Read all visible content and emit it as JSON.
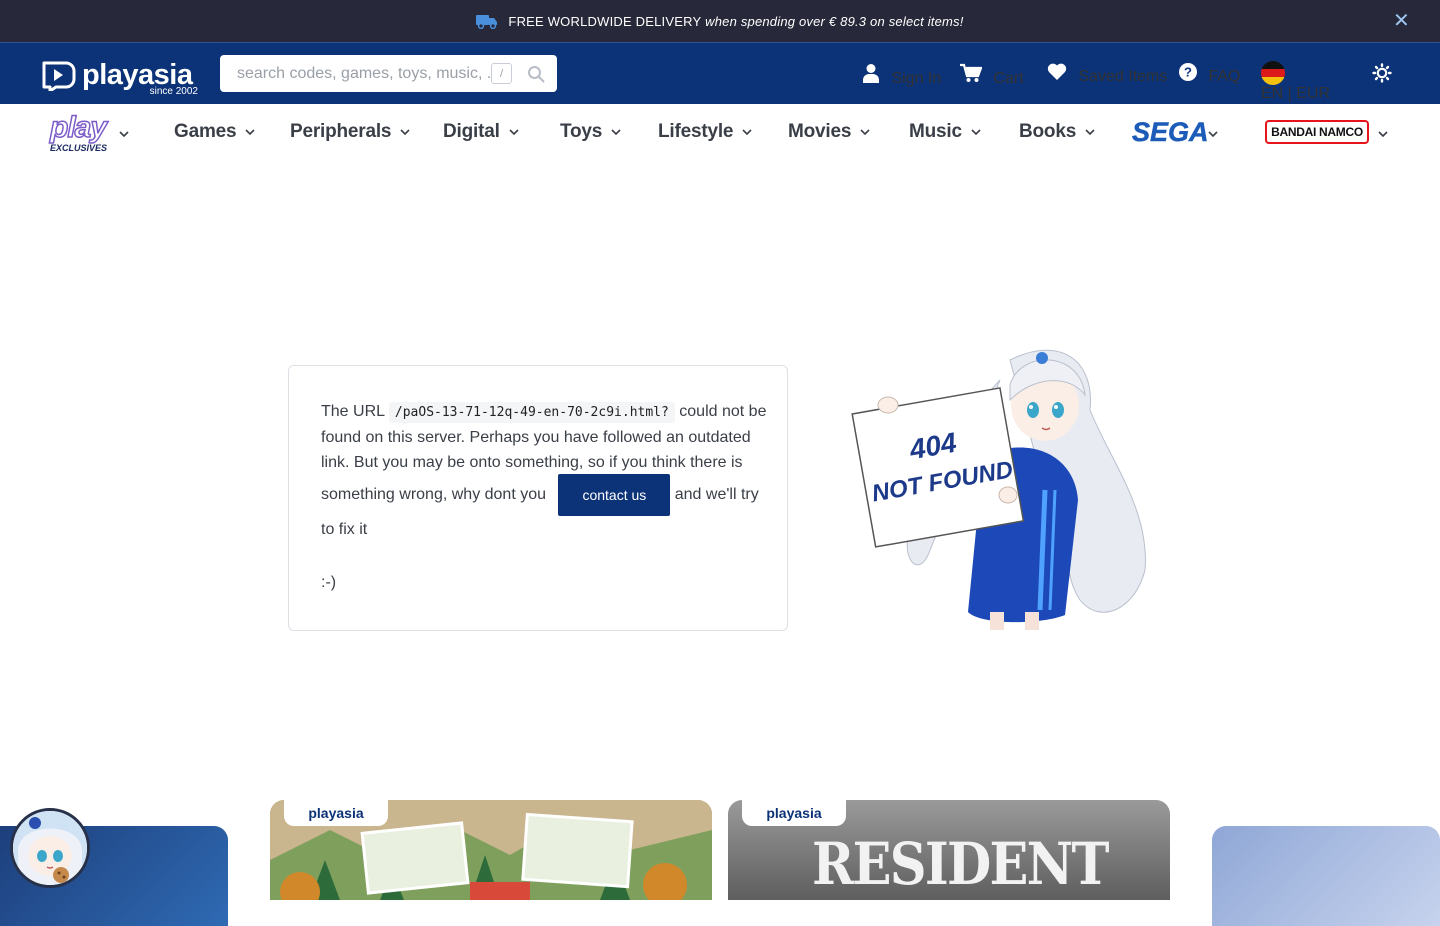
{
  "promo": {
    "text_caps": "FREE WORLDWIDE DELIVERY",
    "text_rest": "when spending over € 89.3 on select items!",
    "close": "✕"
  },
  "header": {
    "logo_word": "playasia",
    "logo_since": "since 2002",
    "search_placeholder": "search codes, games, toys, music, ...",
    "search_shortcut": "/",
    "nav": {
      "signin": "Sign In",
      "cart": "Cart",
      "saved": "Saved Items",
      "faq": "FAQ",
      "lang": "EN | EUR"
    }
  },
  "categories": {
    "play_top": "play",
    "play_bottom": "EXCLUSIVES",
    "items": [
      "Games",
      "Peripherals",
      "Digital",
      "Toys",
      "Lifestyle",
      "Movies",
      "Music",
      "Books"
    ],
    "sega": "SEGA",
    "bandai": "BANDAI NAMCO"
  },
  "error": {
    "pre_url": "The URL",
    "url": "/paOS-13-71-12q-49-en-70-2c9i.html?",
    "after_url": "could not be",
    "line2": "found on this server. Perhaps you have followed an outdated",
    "line3": "link. But you may be onto something, so if you think there is",
    "line4_pre": "something wrong, why dont you",
    "contact": "contact us",
    "line4_post": "and we'll try",
    "line5": "to fix it",
    "smile": ":-)"
  },
  "mascot": {
    "sign_line1": "404",
    "sign_line2": "NOT FOUND"
  },
  "banners": {
    "tag": "playasia",
    "re_title": "RESIDENT EVIL"
  },
  "colors": {
    "promo_bg": "#272839",
    "header_bg": "#0c3377",
    "accent": "#0c3377"
  }
}
